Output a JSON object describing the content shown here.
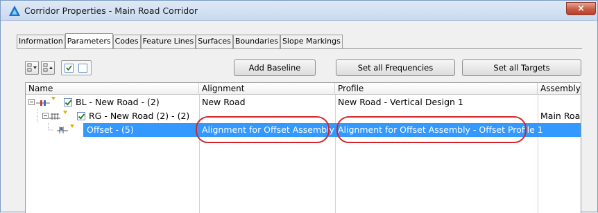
{
  "window": {
    "title": "Corridor Properties - Main Road Corridor",
    "close_label": "×"
  },
  "tabs": [
    {
      "label": "Information",
      "active": false
    },
    {
      "label": "Parameters",
      "active": true
    },
    {
      "label": "Codes",
      "active": false
    },
    {
      "label": "Feature Lines",
      "active": false
    },
    {
      "label": "Surfaces",
      "active": false
    },
    {
      "label": "Boundaries",
      "active": false
    },
    {
      "label": "Slope Markings",
      "active": false
    }
  ],
  "toolbar": {
    "add_baseline": "Add Baseline",
    "set_all_frequencies": "Set all Frequencies",
    "set_all_targets": "Set all Targets"
  },
  "grid": {
    "columns": [
      "Name",
      "Alignment",
      "Profile",
      "Assembly"
    ],
    "rows": [
      {
        "name": "BL - New Road - (2)",
        "alignment": "New Road",
        "profile": "New Road - Vertical Design 1",
        "assembly": "",
        "selected": false
      },
      {
        "name": "RG - New Road (2) - (2)",
        "alignment": "",
        "profile": "",
        "assembly": "Main Road",
        "selected": false
      },
      {
        "name": "Offset - (5)",
        "alignment": "Alignment for Offset Assembly",
        "profile": "Alignment for Offset Assembly - Offset Profile 1",
        "assembly": "",
        "selected": true
      }
    ]
  },
  "colors": {
    "selection": "#3399ff",
    "highlight_ring": "#d4242a",
    "column_line": "#f4c4c4"
  }
}
